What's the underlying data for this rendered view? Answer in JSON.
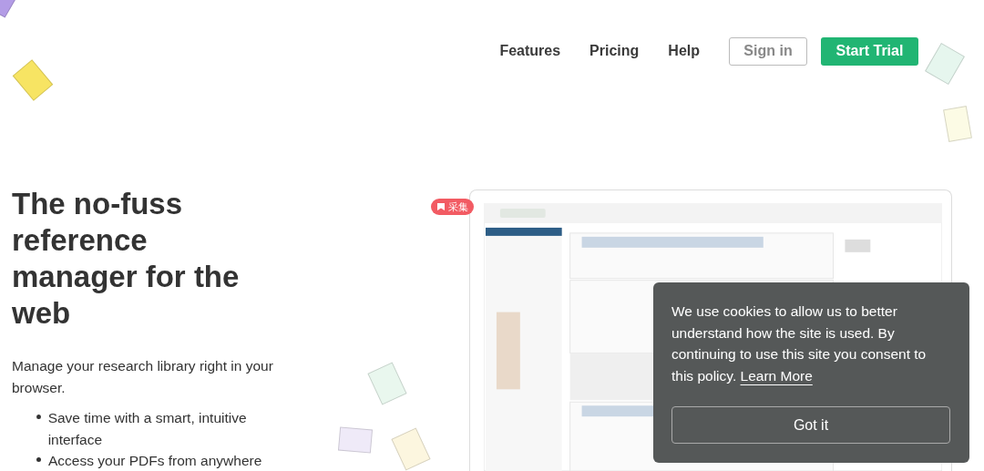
{
  "nav": {
    "links": [
      "Features",
      "Pricing",
      "Help"
    ],
    "sign_in": "Sign in",
    "start_trial": "Start Trial"
  },
  "hero": {
    "title": "The no-fuss reference manager for the web",
    "intro": "Manage your research library right in your browser.",
    "bullets": [
      "Save time with a smart, intuitive interface",
      "Access your PDFs from anywhere"
    ]
  },
  "badge": "采集",
  "cookie": {
    "text": "We use cookies to allow us to better understand how the site is used. By continuing to use this site you consent to this policy.",
    "link": "Learn More",
    "button": "Got it"
  }
}
